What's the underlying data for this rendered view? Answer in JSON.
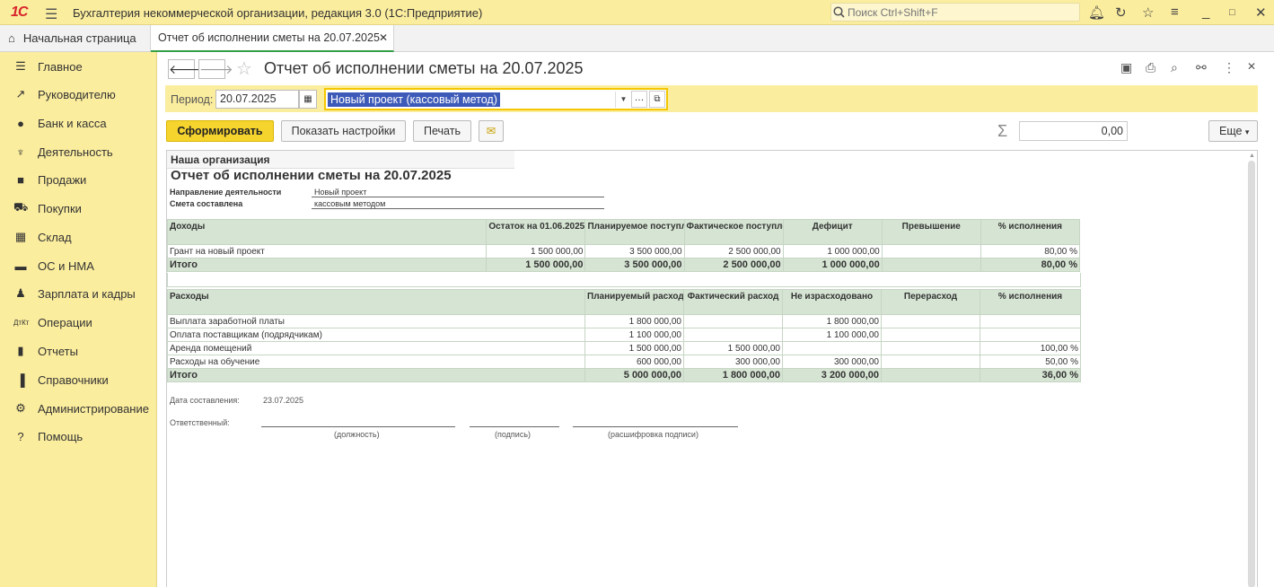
{
  "app": {
    "logo": "1С",
    "title": "Бухгалтерия некоммерческой организации, редакция 3.0  (1С:Предприятие)",
    "search_placeholder": "Поиск Ctrl+Shift+F"
  },
  "tabs": {
    "home": "Начальная страница",
    "active": "Отчет об исполнении сметы на 20.07.2025"
  },
  "sidebar": {
    "items": [
      "Главное",
      "Руководителю",
      "Банк и касса",
      "Деятельность",
      "Продажи",
      "Покупки",
      "Склад",
      "ОС и НМА",
      "Зарплата и кадры",
      "Операции",
      "Отчеты",
      "Справочники",
      "Администрирование",
      "Помощь"
    ]
  },
  "form": {
    "title": "Отчет об исполнении сметы на 20.07.2025",
    "period_label": "Период:",
    "period_value": "20.07.2025",
    "project_value": "Новый проект (кассовый метод)",
    "btn_generate": "Сформировать",
    "btn_settings": "Показать настройки",
    "btn_print": "Печать",
    "sum_value": "0,00",
    "btn_more": "Еще"
  },
  "report": {
    "org": "Наша организация",
    "title": "Отчет об исполнении сметы на 20.07.2025",
    "direction_label": "Направление деятельности",
    "direction_value": "Новый проект",
    "smeta_label": "Смета составлена",
    "smeta_value": "кассовым методом",
    "income": {
      "headers": [
        "Доходы",
        "Остаток на 01.06.2025",
        "Планируемое поступление",
        "Фактическое поступление",
        "Дефицит",
        "Превышение",
        "% исполнения"
      ],
      "rows": [
        [
          "Грант на новый проект",
          "1 500 000,00",
          "3 500 000,00",
          "2 500 000,00",
          "1 000 000,00",
          "",
          "80,00 %"
        ]
      ],
      "total": [
        "Итого",
        "1 500 000,00",
        "3 500 000,00",
        "2 500 000,00",
        "1 000 000,00",
        "",
        "80,00 %"
      ]
    },
    "expense": {
      "headers": [
        "Расходы",
        "Планируемый расход",
        "Фактический расход",
        "Не израсходовано",
        "Перерасход",
        "% исполнения"
      ],
      "rows": [
        [
          "Выплата заработной платы",
          "1 800 000,00",
          "",
          "1 800 000,00",
          "",
          ""
        ],
        [
          "Оплата поставщикам (подрядчикам)",
          "1 100 000,00",
          "",
          "1 100 000,00",
          "",
          ""
        ],
        [
          "Аренда помещений",
          "1 500 000,00",
          "1 500 000,00",
          "",
          "",
          "100,00 %"
        ],
        [
          "Расходы на обучение",
          "600 000,00",
          "300 000,00",
          "300 000,00",
          "",
          "50,00 %"
        ]
      ],
      "total": [
        "Итого",
        "5 000 000,00",
        "1 800 000,00",
        "3 200 000,00",
        "",
        "36,00 %"
      ]
    },
    "date_label": "Дата составления:",
    "date_value": "23.07.2025",
    "responsible_label": "Ответственный:",
    "sig_position": "(должность)",
    "sig_signature": "(подпись)",
    "sig_decode": "(расшифровка подписи)"
  }
}
